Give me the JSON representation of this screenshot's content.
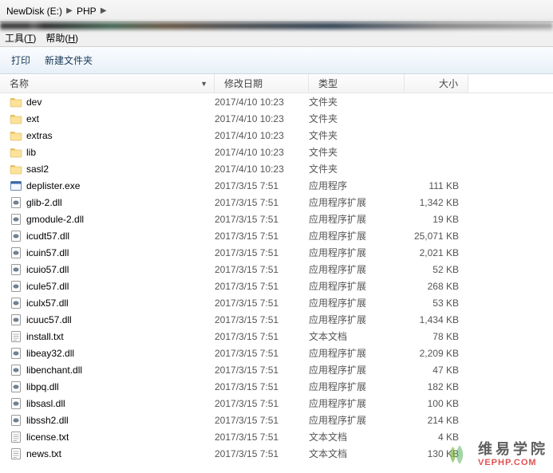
{
  "breadcrumb": {
    "part1": "NewDisk (E:)",
    "part2": "PHP"
  },
  "menu": {
    "tools": "工具(T)",
    "help": "帮助(H)",
    "tools_u": "T",
    "help_u": "H"
  },
  "toolbar": {
    "print": "打印",
    "newfolder": "新建文件夹"
  },
  "columns": {
    "name": "名称",
    "date": "修改日期",
    "type": "类型",
    "size": "大小"
  },
  "types": {
    "folder": "文件夹",
    "exe": "应用程序",
    "dll": "应用程序扩展",
    "txt": "文本文档"
  },
  "files": [
    {
      "icon": "folder",
      "name": "dev",
      "date": "2017/4/10 10:23",
      "typekey": "folder",
      "size": ""
    },
    {
      "icon": "folder",
      "name": "ext",
      "date": "2017/4/10 10:23",
      "typekey": "folder",
      "size": ""
    },
    {
      "icon": "folder",
      "name": "extras",
      "date": "2017/4/10 10:23",
      "typekey": "folder",
      "size": ""
    },
    {
      "icon": "folder",
      "name": "lib",
      "date": "2017/4/10 10:23",
      "typekey": "folder",
      "size": ""
    },
    {
      "icon": "folder",
      "name": "sasl2",
      "date": "2017/4/10 10:23",
      "typekey": "folder",
      "size": ""
    },
    {
      "icon": "exe",
      "name": "deplister.exe",
      "date": "2017/3/15 7:51",
      "typekey": "exe",
      "size": "111 KB"
    },
    {
      "icon": "dll",
      "name": "glib-2.dll",
      "date": "2017/3/15 7:51",
      "typekey": "dll",
      "size": "1,342 KB"
    },
    {
      "icon": "dll",
      "name": "gmodule-2.dll",
      "date": "2017/3/15 7:51",
      "typekey": "dll",
      "size": "19 KB"
    },
    {
      "icon": "dll",
      "name": "icudt57.dll",
      "date": "2017/3/15 7:51",
      "typekey": "dll",
      "size": "25,071 KB"
    },
    {
      "icon": "dll",
      "name": "icuin57.dll",
      "date": "2017/3/15 7:51",
      "typekey": "dll",
      "size": "2,021 KB"
    },
    {
      "icon": "dll",
      "name": "icuio57.dll",
      "date": "2017/3/15 7:51",
      "typekey": "dll",
      "size": "52 KB"
    },
    {
      "icon": "dll",
      "name": "icule57.dll",
      "date": "2017/3/15 7:51",
      "typekey": "dll",
      "size": "268 KB"
    },
    {
      "icon": "dll",
      "name": "iculx57.dll",
      "date": "2017/3/15 7:51",
      "typekey": "dll",
      "size": "53 KB"
    },
    {
      "icon": "dll",
      "name": "icuuc57.dll",
      "date": "2017/3/15 7:51",
      "typekey": "dll",
      "size": "1,434 KB"
    },
    {
      "icon": "txt",
      "name": "install.txt",
      "date": "2017/3/15 7:51",
      "typekey": "txt",
      "size": "78 KB"
    },
    {
      "icon": "dll",
      "name": "libeay32.dll",
      "date": "2017/3/15 7:51",
      "typekey": "dll",
      "size": "2,209 KB"
    },
    {
      "icon": "dll",
      "name": "libenchant.dll",
      "date": "2017/3/15 7:51",
      "typekey": "dll",
      "size": "47 KB"
    },
    {
      "icon": "dll",
      "name": "libpq.dll",
      "date": "2017/3/15 7:51",
      "typekey": "dll",
      "size": "182 KB"
    },
    {
      "icon": "dll",
      "name": "libsasl.dll",
      "date": "2017/3/15 7:51",
      "typekey": "dll",
      "size": "100 KB"
    },
    {
      "icon": "dll",
      "name": "libssh2.dll",
      "date": "2017/3/15 7:51",
      "typekey": "dll",
      "size": "214 KB"
    },
    {
      "icon": "txt",
      "name": "license.txt",
      "date": "2017/3/15 7:51",
      "typekey": "txt",
      "size": "4 KB"
    },
    {
      "icon": "txt",
      "name": "news.txt",
      "date": "2017/3/15 7:51",
      "typekey": "txt",
      "size": "130 KB"
    }
  ],
  "watermark": {
    "cn": "维易学院",
    "en": "VEPHP.COM"
  }
}
